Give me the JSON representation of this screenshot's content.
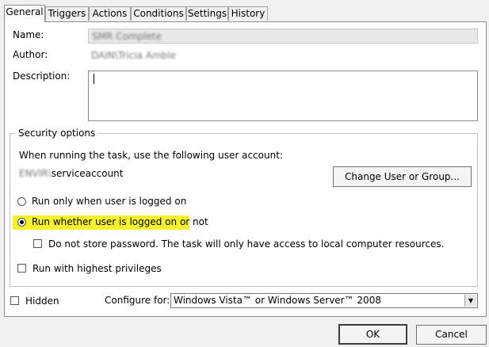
{
  "tabs": [
    {
      "label": "General",
      "active": true
    },
    {
      "label": "Triggers"
    },
    {
      "label": "Actions"
    },
    {
      "label": "Conditions"
    },
    {
      "label": "Settings"
    },
    {
      "label": "History"
    }
  ],
  "general": {
    "name_label": "Name:",
    "name_value": "SMR Complete",
    "author_label": "Author:",
    "author_value": "DAIN\\Tricia Amble",
    "description_label": "Description:",
    "description_value": ""
  },
  "security": {
    "title": "Security options",
    "account_prompt": "When running the task, use the following user account:",
    "account_domain": "ENVIR\\",
    "account_name": "serviceaccount",
    "change_button": "Change User or Group...",
    "radio_logged_on": "Run only when user is logged on",
    "radio_whether": "Run whether user is logged on or not",
    "do_not_store": "Do not store password.  The task will only have access to local computer resources.",
    "highest_privileges": "Run with highest privileges",
    "selected": "whether",
    "highlight_color": "#f5f22a"
  },
  "bottom": {
    "hidden_label": "Hidden",
    "configure_label": "Configure for:",
    "configure_value": "Windows Vista™ or Windows Server™ 2008"
  },
  "footer": {
    "ok": "OK",
    "cancel": "Cancel"
  }
}
